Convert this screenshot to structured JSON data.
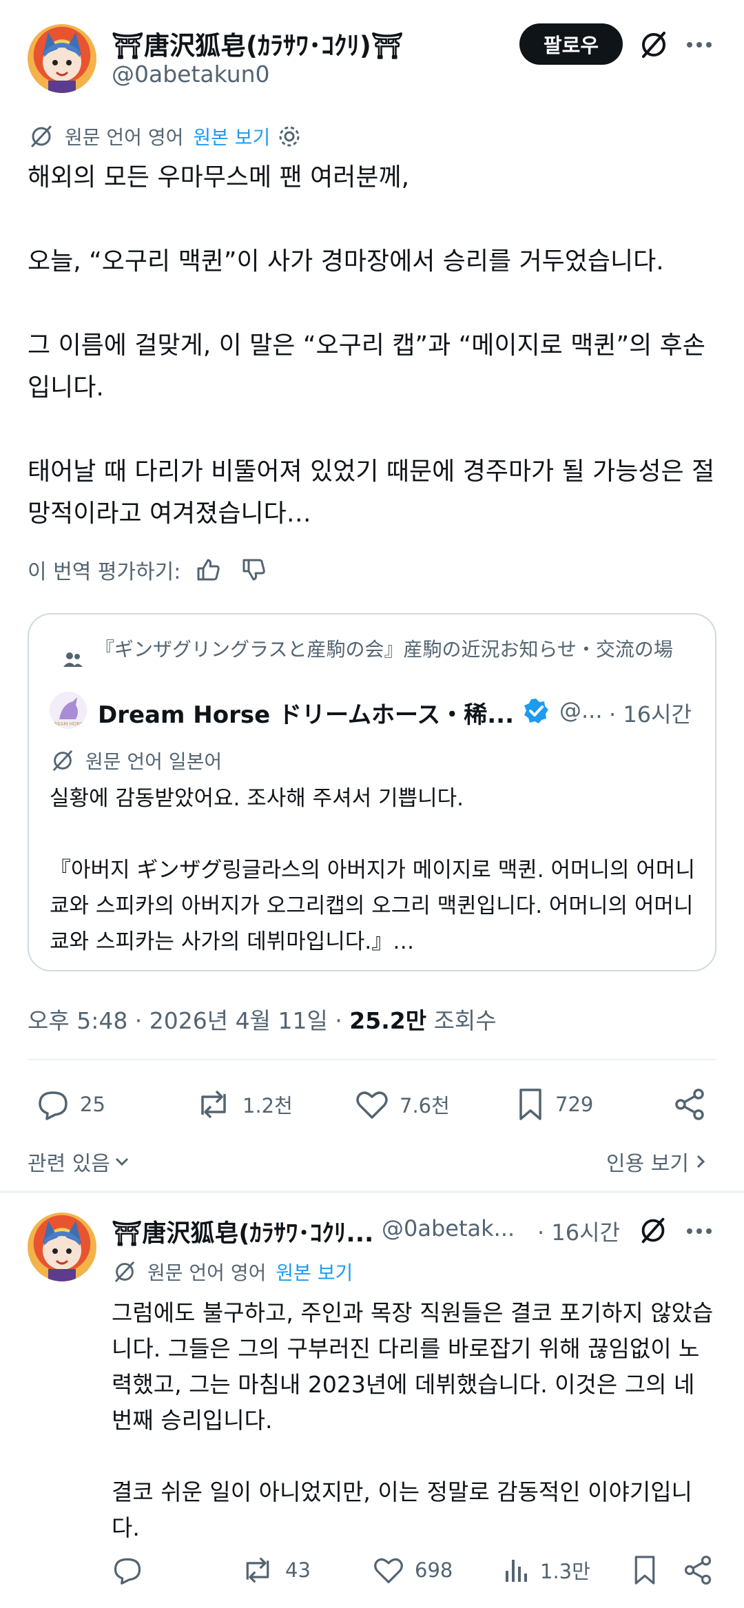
{
  "post": {
    "author_name": "⛩唐沢狐皂(ｶﾗｻﾜ･ｺｸﾘ)⛩",
    "handle": "@0abetakun0",
    "follow_label": "팔로우",
    "translation_note": "원문 언어 영어",
    "view_original": "원본 보기",
    "body": "해외의 모든 우마무스메 팬 여러분께,\n\n오늘, “오구리 맥퀸”이 사가 경마장에서 승리를 거두었습니다.\n\n그 이름에 걸맞게, 이 말은 “오구리 캡”과 “메이지로 맥퀸”의 후손입니다.\n\n태어날 때 다리가 비뚤어져 있었기 때문에 경주마가 될 가능성은 절망적이라고 여겨졌습니다…",
    "rate_label": "이 번역 평가하기:",
    "timestamp": "오후 5:48 · 2026년 4월 11일 · ",
    "views_count": "25.2만",
    "views_label": " 조회수",
    "actions": {
      "replies": "25",
      "reposts": "1.2천",
      "likes": "7.6천",
      "bookmarks": "729"
    },
    "related_label": "관련 있음",
    "quotes_label": "인용 보기"
  },
  "quote": {
    "community": "『ギンザグリングラスと産駒の会』産駒の近況お知らせ・交流の場",
    "author_name": "Dream Horse ドリームホース・稀...",
    "handle": "@...",
    "time": "· 16시간",
    "translation_note": "원문 언어 일본어",
    "text": "실황에 감동받았어요. 조사해 주셔서 기쁩니다.\n\n『아버지 ギンザグ링글라스의 아버지가 메이지로 맥퀸. 어머니의 어머니 쿄와 스피카의 아버지가 오그리캡의 오그리 맥퀸입니다. 어머니의 어머니 쿄와 스피카는 사가의 데뷔마입니다.』…",
    "logo_text": "DREAM HORSE"
  },
  "reply": {
    "author_name": "⛩唐沢狐皂(ｶﾗｻﾜ･ｺｸﾘ...",
    "handle": "@0abetak...",
    "time": "· 16시간",
    "translation_note": "원문 언어 영어",
    "view_original": "원본 보기",
    "body": "그럼에도 불구하고, 주인과 목장 직원들은 결코 포기하지 않았습니다. 그들은 그의 구부러진 다리를 바로잡기 위해 끊임없이 노력했고, 그는 마침내 2023년에 데뷔했습니다. 이것은 그의 네 번째 승리입니다.\n\n결코 쉬운 일이 아니었지만, 이는 정말로 감동적인 이야기입니다.",
    "actions": {
      "reposts": "43",
      "likes": "698",
      "views": "1.3만"
    }
  },
  "colors": {
    "accent": "#1d9bf0",
    "text": "#0f1419",
    "muted": "#536471",
    "border": "#cfd9de"
  }
}
